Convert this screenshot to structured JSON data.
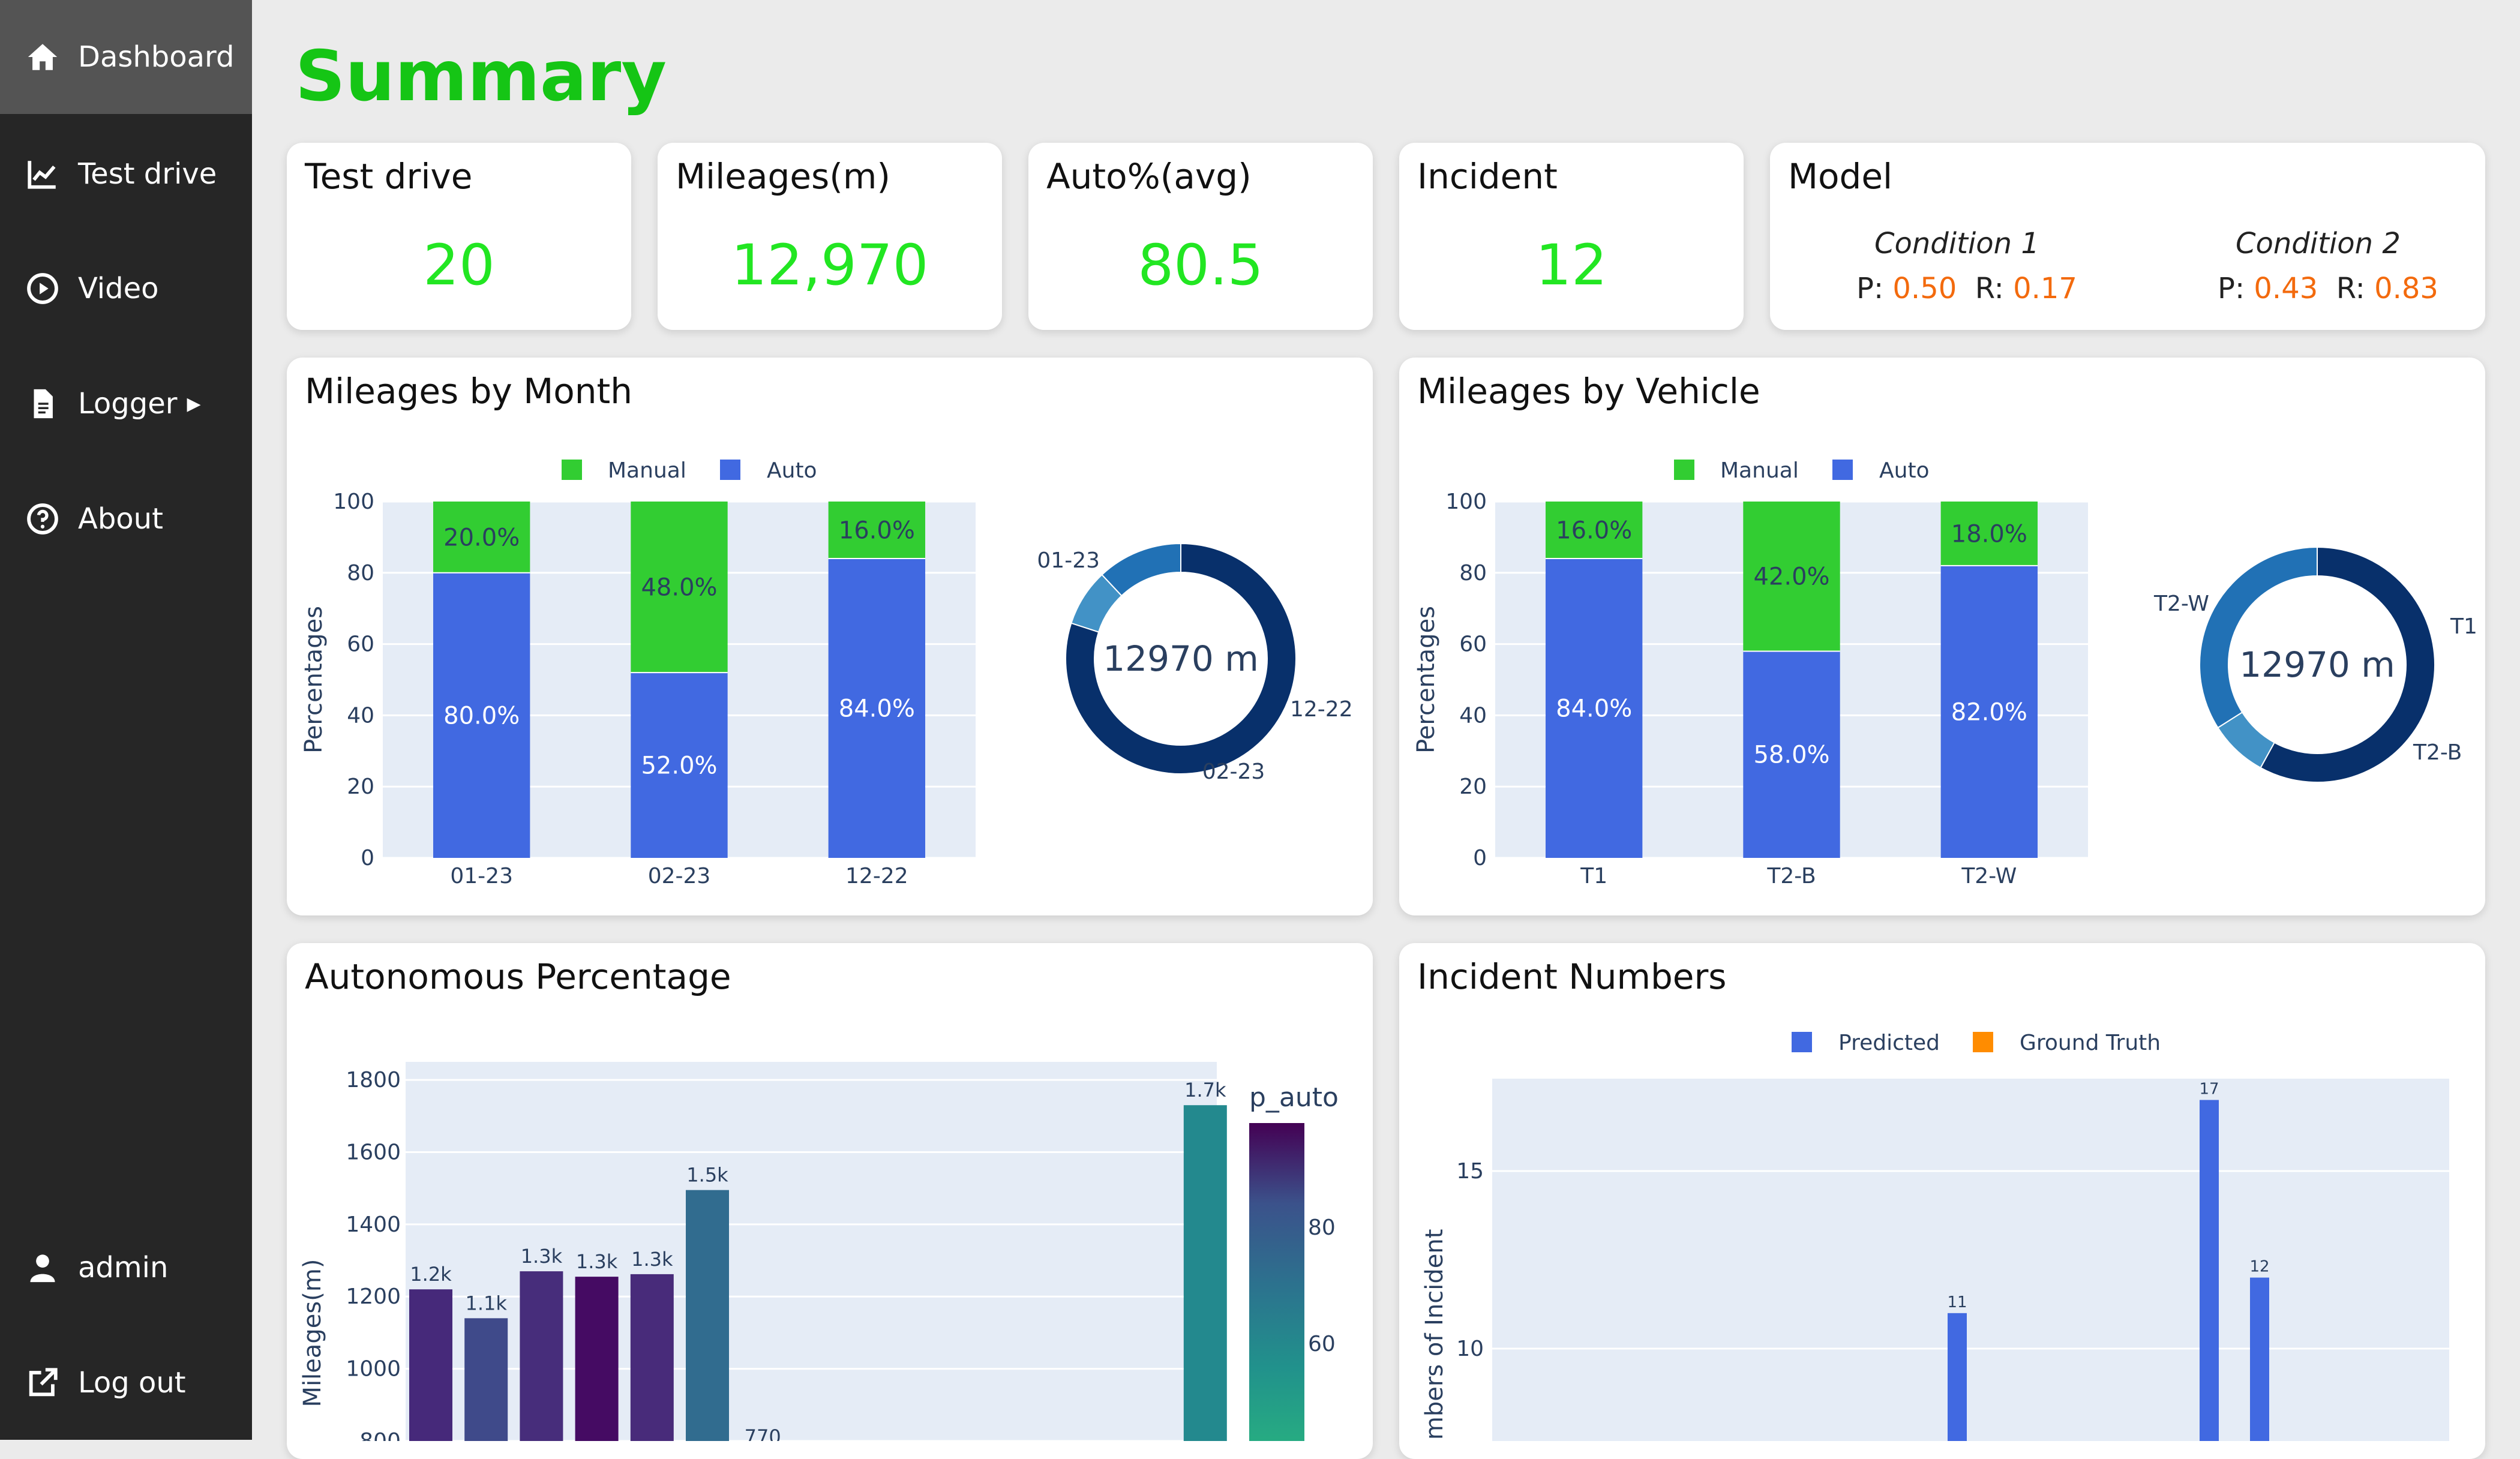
{
  "sidebar": {
    "items": [
      {
        "label": "Dashboard",
        "icon": "home-icon",
        "active": true
      },
      {
        "label": "Test drive",
        "icon": "line-chart-icon"
      },
      {
        "label": "Video",
        "icon": "play-circle-icon"
      },
      {
        "label": "Logger",
        "icon": "file-icon",
        "has_submenu": true
      },
      {
        "label": "About",
        "icon": "question-circle-icon"
      }
    ],
    "user": {
      "label": "admin",
      "icon": "user-icon"
    },
    "logout": {
      "label": "Log out",
      "icon": "external-link-icon"
    }
  },
  "page": {
    "title": "Summary"
  },
  "kpis": [
    {
      "title": "Test drive",
      "value": "20"
    },
    {
      "title": "Mileages(m)",
      "value": "12,970"
    },
    {
      "title": "Auto%(avg)",
      "value": "80.5"
    },
    {
      "title": "Incident",
      "value": "12"
    }
  ],
  "model": {
    "title": "Model",
    "conditions": [
      {
        "name": "Condition 1",
        "p_label": "P:",
        "p_value": "0.50",
        "r_label": "R:",
        "r_value": "0.17"
      },
      {
        "name": "Condition 2",
        "p_label": "P:",
        "p_value": "0.43",
        "r_label": "R:",
        "r_value": "0.83"
      }
    ]
  },
  "colors": {
    "accent_green": "#15c515",
    "kpi_green": "#22e622",
    "manual": "#32cd32",
    "auto": "#4169e1",
    "predicted": "#4169e1",
    "ground_truth": "#ff8c00",
    "metric_orange": "#f36a0d",
    "plot_bg": "#e5ecf6"
  },
  "chart_data": [
    {
      "panel_title": "Mileages by Month",
      "type": "bar",
      "stacked": true,
      "categories": [
        "01-23",
        "02-23",
        "12-22"
      ],
      "series": [
        {
          "name": "Auto",
          "values": [
            80.0,
            52.0,
            84.0
          ],
          "labels": [
            "80.0%",
            "52.0%",
            "84.0%"
          ]
        },
        {
          "name": "Manual",
          "values": [
            20.0,
            48.0,
            16.0
          ],
          "labels": [
            "20.0%",
            "48.0%",
            "16.0%"
          ]
        }
      ],
      "ylabel": "Percentages",
      "ylim": [
        0,
        100
      ],
      "yticks": [
        "0",
        "20",
        "40",
        "60",
        "80",
        "100"
      ],
      "legend": [
        "Manual",
        "Auto"
      ],
      "legend_position": "top-center",
      "grid": true,
      "donut": {
        "type": "pie",
        "center_label": "12970 m",
        "slices": [
          {
            "label": "01-23",
            "value": 0.8,
            "color": "#08306b"
          },
          {
            "label": "12-22",
            "value": 0.08,
            "color": "#4292c6"
          },
          {
            "label": "02-23",
            "value": 0.12,
            "color": "#2171b5"
          }
        ]
      }
    },
    {
      "panel_title": "Mileages by Vehicle",
      "type": "bar",
      "stacked": true,
      "categories": [
        "T1",
        "T2-B",
        "T2-W"
      ],
      "series": [
        {
          "name": "Auto",
          "values": [
            84.0,
            58.0,
            82.0
          ],
          "labels": [
            "84.0%",
            "58.0%",
            "82.0%"
          ]
        },
        {
          "name": "Manual",
          "values": [
            16.0,
            42.0,
            18.0
          ],
          "labels": [
            "16.0%",
            "42.0%",
            "18.0%"
          ]
        }
      ],
      "ylabel": "Percentages",
      "ylim": [
        0,
        100
      ],
      "yticks": [
        "0",
        "20",
        "40",
        "60",
        "80",
        "100"
      ],
      "legend": [
        "Manual",
        "Auto"
      ],
      "legend_position": "top-center",
      "grid": true,
      "donut": {
        "type": "pie",
        "center_label": "12970 m",
        "slices": [
          {
            "label": "T2-W",
            "value": 0.58,
            "color": "#08306b"
          },
          {
            "label": "T1",
            "value": 0.08,
            "color": "#4292c6"
          },
          {
            "label": "T2-B",
            "value": 0.34,
            "color": "#2171b5"
          }
        ]
      }
    },
    {
      "panel_title": "Autonomous Percentage",
      "type": "bar",
      "values": [
        1220,
        1140,
        1270,
        1255,
        1262,
        1495,
        770,
        1730
      ],
      "x_positions": [
        0,
        1,
        2,
        3,
        4,
        5,
        6,
        14
      ],
      "bar_labels": [
        "1.2k",
        "1.1k",
        "1.3k",
        "1.3k",
        "1.3k",
        "1.5k",
        "770",
        "1.7k"
      ],
      "bar_colors": [
        "#46297a",
        "#3f4a8a",
        "#472d7b",
        "#450b63",
        "#482b7a",
        "#316c8f",
        "#2a788e",
        "#23898e"
      ],
      "ylabel": "Mileages(m)",
      "ylim": [
        800,
        1850
      ],
      "yticks": [
        "800",
        "1000",
        "1200",
        "1400",
        "1600",
        "1800"
      ],
      "colorbar": {
        "title": "p_auto",
        "ticks": [
          "60",
          "80"
        ]
      },
      "grid": true
    },
    {
      "panel_title": "Incident Numbers",
      "type": "bar",
      "series": [
        {
          "name": "Predicted",
          "x": [
            9,
            14,
            15
          ],
          "values": [
            11,
            17,
            12
          ],
          "labels": [
            "11",
            "17",
            "12"
          ]
        },
        {
          "name": "Ground Truth",
          "values": []
        }
      ],
      "legend": [
        "Predicted",
        "Ground Truth"
      ],
      "legend_position": "top-center",
      "ylabel": "Numbers of Incident",
      "ylim": [
        7.4,
        17.6
      ],
      "yticks": [
        "10",
        "15"
      ],
      "grid": true
    }
  ]
}
